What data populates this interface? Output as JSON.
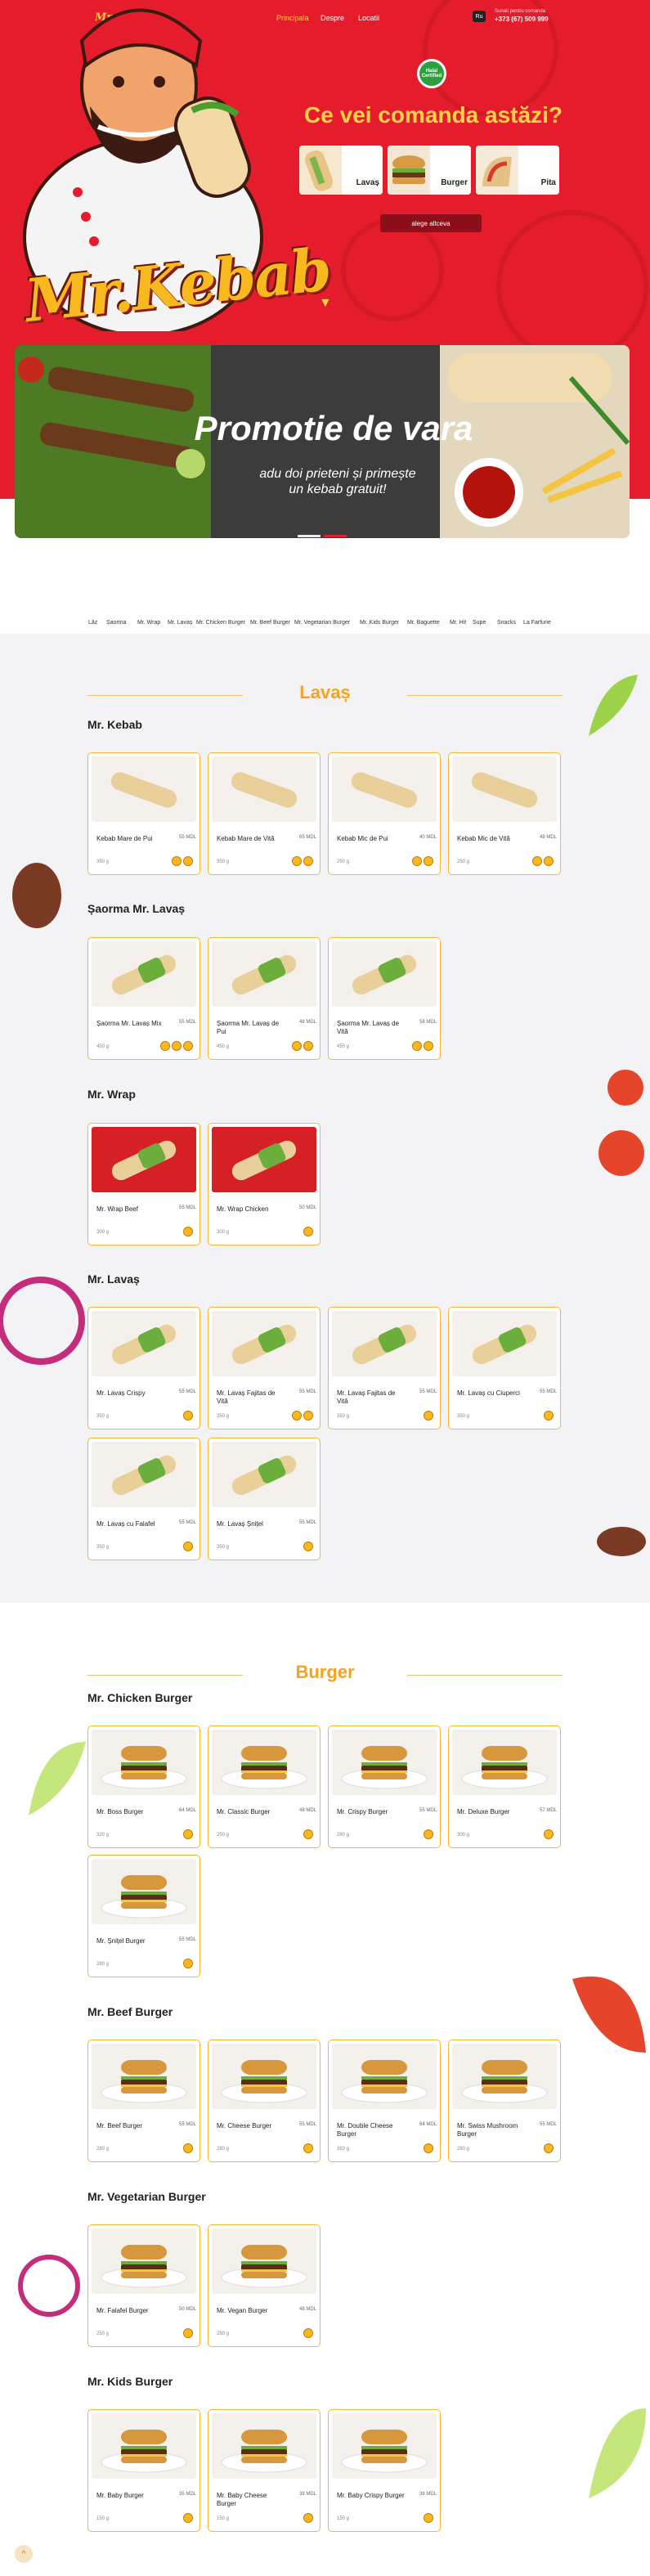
{
  "header": {
    "logo": "Mr. Kebab",
    "nav": [
      "Principala",
      "Despre",
      "Locatii"
    ],
    "active_nav": 0,
    "lang": "Ru",
    "phone_label": "Sunati pentru comanda",
    "phone": "+373 (67) 509 999"
  },
  "hero": {
    "brand": "Mr.Kebab",
    "halal": "Halal Certified",
    "question": "Ce vei comanda astăzi?",
    "categories": [
      {
        "label": "Lavaș",
        "icon": "lavash-icon"
      },
      {
        "label": "Burger",
        "icon": "burger-icon"
      },
      {
        "label": "Pita",
        "icon": "pita-icon"
      }
    ],
    "cta": "alege altceva"
  },
  "banner": {
    "title": "Promotie de vara",
    "subtitle_line1": "adu doi prieteni și primește",
    "subtitle_line2": "un kebab gratuit!",
    "colors": {
      "active_dot": "#e51c2b",
      "inactive_dot": "#ffffff"
    }
  },
  "category_nav": [
    "Lăz",
    "Șaorma",
    "Mr. Wrap",
    "Mr. Lavaș",
    "Mr. Chicken Burger",
    "Mr. Beef Burger",
    "Mr. Vegetarian Burger",
    "Mr. Kids Burger",
    "Mr. Baguette",
    "Mr. Hit",
    "Supe",
    "Snacks",
    "La Farfurie"
  ],
  "sections": [
    {
      "title": "Lavaș",
      "groups": [
        {
          "title": "Mr. Kebab",
          "items": [
            {
              "name": "Kebab Mare de Pui",
              "price": "55 MDL",
              "weight": "350 g",
              "icons": 2
            },
            {
              "name": "Kebab Mare de Vită",
              "price": "65 MDL",
              "weight": "350 g",
              "icons": 2
            },
            {
              "name": "Kebab Mic de Pui",
              "price": "40 MDL",
              "weight": "250 g",
              "icons": 2
            },
            {
              "name": "Kebab Mic de Vită",
              "price": "48 MDL",
              "weight": "250 g",
              "icons": 2
            }
          ]
        },
        {
          "title": "Șaorma Mr. Lavaș",
          "items": [
            {
              "name": "Șaorma Mr. Lavaș Mix",
              "price": "55 MDL",
              "weight": "450 g",
              "icons": 3
            },
            {
              "name": "Șaorma Mr. Lavaș de Pui",
              "price": "48 MDL",
              "weight": "450 g",
              "icons": 2
            },
            {
              "name": "Șaorma Mr. Lavaș de Vită",
              "price": "58 MDL",
              "weight": "450 g",
              "icons": 2
            }
          ]
        },
        {
          "title": "Mr. Wrap",
          "items": [
            {
              "name": "Mr. Wrap Beef",
              "price": "55 MDL",
              "weight": "300 g",
              "icons": 1
            },
            {
              "name": "Mr. Wrap Chicken",
              "price": "50 MDL",
              "weight": "300 g",
              "icons": 1
            }
          ]
        },
        {
          "title": "Mr. Lavaș",
          "items": [
            {
              "name": "Mr. Lavaș Crispy",
              "price": "55 MDL",
              "weight": "350 g",
              "icons": 1
            },
            {
              "name": "Mr. Lavaș Fajitas de Vită",
              "price": "55 MDL",
              "weight": "350 g",
              "icons": 2
            },
            {
              "name": "Mr. Lavaș Fajitas de Vită",
              "price": "55 MDL",
              "weight": "350 g",
              "icons": 1
            },
            {
              "name": "Mr. Lavaș cu Ciuperci",
              "price": "55 MDL",
              "weight": "350 g",
              "icons": 1
            },
            {
              "name": "Mr. Lavaș cu Falafel",
              "price": "55 MDL",
              "weight": "350 g",
              "icons": 1
            },
            {
              "name": "Mr. Lavaș Șnițel",
              "price": "55 MDL",
              "weight": "350 g",
              "icons": 1
            }
          ]
        }
      ]
    },
    {
      "title": "Burger",
      "groups": [
        {
          "title": "Mr. Chicken Burger",
          "items": [
            {
              "name": "Mr. Boss Burger",
              "price": "64 MDL",
              "weight": "320 g",
              "icons": 1
            },
            {
              "name": "Mr. Classic Burger",
              "price": "48 MDL",
              "weight": "250 g",
              "icons": 1
            },
            {
              "name": "Mr. Crispy Burger",
              "price": "55 MDL",
              "weight": "280 g",
              "icons": 1
            },
            {
              "name": "Mr. Deluxe Burger",
              "price": "57 MDL",
              "weight": "300 g",
              "icons": 1
            },
            {
              "name": "Mr. Șnițel Burger",
              "price": "55 MDL",
              "weight": "280 g",
              "icons": 1
            }
          ]
        },
        {
          "title": "Mr. Beef Burger",
          "items": [
            {
              "name": "Mr. Beef Burger",
              "price": "55 MDL",
              "weight": "280 g",
              "icons": 1
            },
            {
              "name": "Mr. Cheese Burger",
              "price": "55 MDL",
              "weight": "280 g",
              "icons": 1
            },
            {
              "name": "Mr. Double Cheese Burger",
              "price": "64 MDL",
              "weight": "350 g",
              "icons": 1
            },
            {
              "name": "Mr. Swiss Mushroom Burger",
              "price": "55 MDL",
              "weight": "280 g",
              "icons": 1
            }
          ]
        },
        {
          "title": "Mr. Vegetarian Burger",
          "items": [
            {
              "name": "Mr. Falafel Burger",
              "price": "50 MDL",
              "weight": "250 g",
              "icons": 1
            },
            {
              "name": "Mr. Vegan Burger",
              "price": "48 MDL",
              "weight": "250 g",
              "icons": 1
            }
          ]
        },
        {
          "title": "Mr. Kids Burger",
          "items": [
            {
              "name": "Mr. Baby Burger",
              "price": "35 MDL",
              "weight": "150 g",
              "icons": 1
            },
            {
              "name": "Mr. Baby Cheese Burger",
              "price": "38 MDL",
              "weight": "150 g",
              "icons": 1
            },
            {
              "name": "Mr. Baby Crispy Burger",
              "price": "38 MDL",
              "weight": "150 g",
              "icons": 1
            }
          ]
        }
      ]
    }
  ],
  "scroll_top": "^",
  "colors": {
    "brand_red": "#e51c2b",
    "accent_yellow": "#f8a21f",
    "card_border": "#f7b733"
  }
}
